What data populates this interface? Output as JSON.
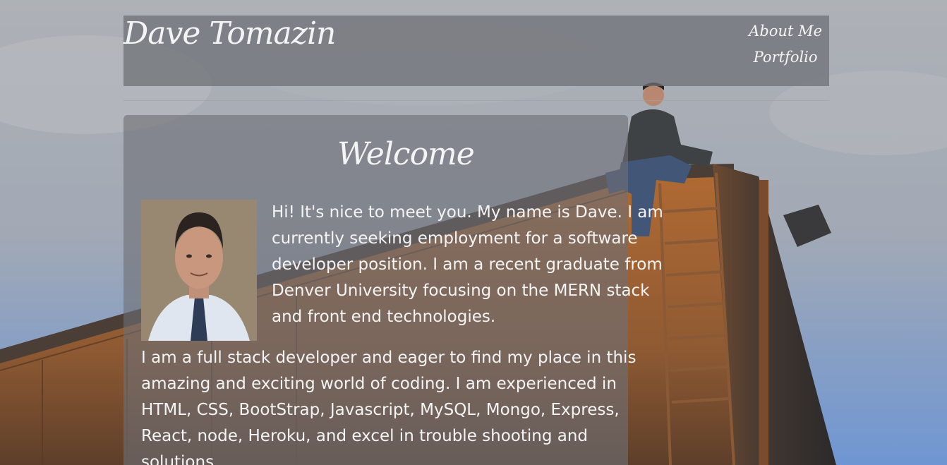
{
  "nav": {
    "brand": "Dave Tomazin",
    "links": [
      "About Me",
      "Portfolio"
    ]
  },
  "main": {
    "heading": "Welcome",
    "intro": "Hi! It's nice to meet you. My name is Dave. I am currently seeking employment for a software developer position. I am a recent graduate from Denver University focusing on the MERN stack and front end technologies.",
    "bio": "I am a full stack developer and eager to find my place in this amazing and exciting world of coding. I am experienced in HTML, CSS, BootStrap, Javascript, MySQL, Mongo, Express, React, node, Heroku, and excel in trouble shooting and solutions."
  },
  "colors": {
    "text": "#f4f4f4",
    "panel": "#6e7076",
    "sky": "#a9adb4",
    "rust": "#a0622f"
  }
}
